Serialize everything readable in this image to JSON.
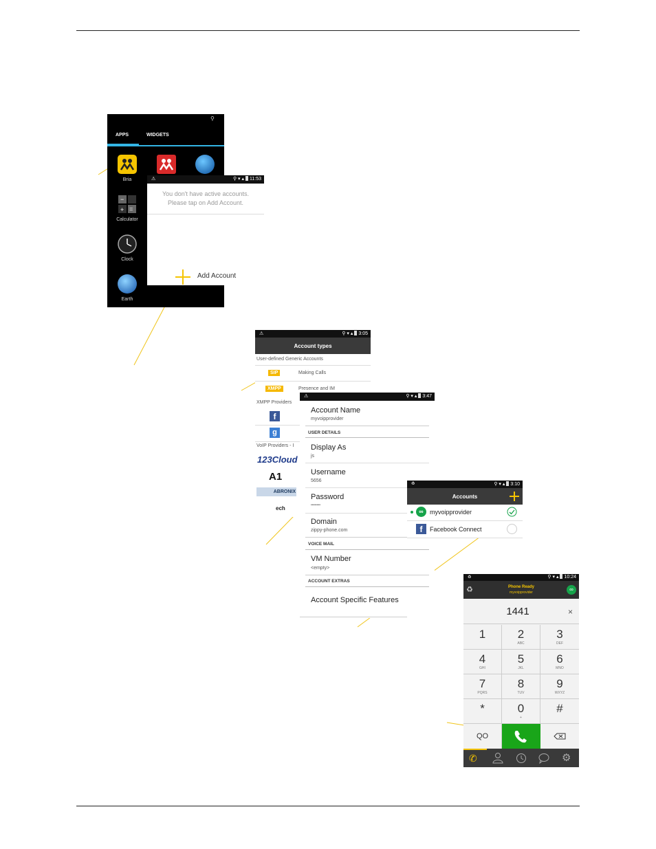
{
  "screen1": {
    "tabs": [
      "APPS",
      "WIDGETS"
    ],
    "apps": [
      {
        "label": "Bria",
        "icon": "bria-icon"
      },
      {
        "label": "Calculator",
        "icon": "calculator-icon"
      },
      {
        "label": "Clock",
        "icon": "clock-icon"
      },
      {
        "label": "Earth",
        "icon": "earth-icon"
      }
    ]
  },
  "screen2": {
    "time": "11:53",
    "message_line1": "You don't have active accounts.",
    "message_line2": "Please tap on Add Account.",
    "add_account": "Add Account"
  },
  "screen3": {
    "time": "3:05",
    "title": "Account types",
    "section_generic": "User-defined Generic Accounts",
    "sip_badge": "SIP",
    "sip_desc": "Making Calls",
    "xmpp_badge": "XMPP",
    "xmpp_desc": "Presence and IM",
    "section_xmpp": "XMPP Providers",
    "section_voip": "VoIP Providers - I",
    "voip_logos": [
      "123Cloud",
      "A1",
      "ABRONIX",
      "ech"
    ]
  },
  "screen4": {
    "time": "3:47",
    "account_name_label": "Account Name",
    "account_name_value": "myvoipprovider",
    "section_user": "USER DETAILS",
    "display_as_label": "Display As",
    "display_as_value": "js",
    "username_label": "Username",
    "username_value": "5656",
    "password_label": "Password",
    "password_value": "••••••••",
    "domain_label": "Domain",
    "domain_value": "zippy-phone.com",
    "section_vm": "VOICE MAIL",
    "vm_label": "VM Number",
    "vm_value": "<empty>",
    "section_extras": "ACCOUNT EXTRAS",
    "extras_label": "Account Specific Features"
  },
  "screen5": {
    "time": "3:10",
    "title": "Accounts",
    "accounts": [
      {
        "name": "myvoipprovider"
      },
      {
        "name": "Facebook Connect"
      }
    ]
  },
  "screen6": {
    "time": "10:24",
    "status_line1": "Phone Ready",
    "status_line2": "myvoipprovider",
    "number": "1441",
    "keys": [
      {
        "n": "1",
        "s": ""
      },
      {
        "n": "2",
        "s": "ABC"
      },
      {
        "n": "3",
        "s": "DEF"
      },
      {
        "n": "4",
        "s": "GHI"
      },
      {
        "n": "5",
        "s": "JKL"
      },
      {
        "n": "6",
        "s": "MNO"
      },
      {
        "n": "7",
        "s": "PQRS"
      },
      {
        "n": "8",
        "s": "TUV"
      },
      {
        "n": "9",
        "s": "WXYZ"
      },
      {
        "n": "*",
        "s": ""
      },
      {
        "n": "0",
        "s": "+"
      },
      {
        "n": "#",
        "s": ""
      }
    ],
    "voicemail_glyph": "QO"
  },
  "colors": {
    "accent": "#f5c400",
    "green": "#16a34a",
    "callout": "#f0c419"
  }
}
